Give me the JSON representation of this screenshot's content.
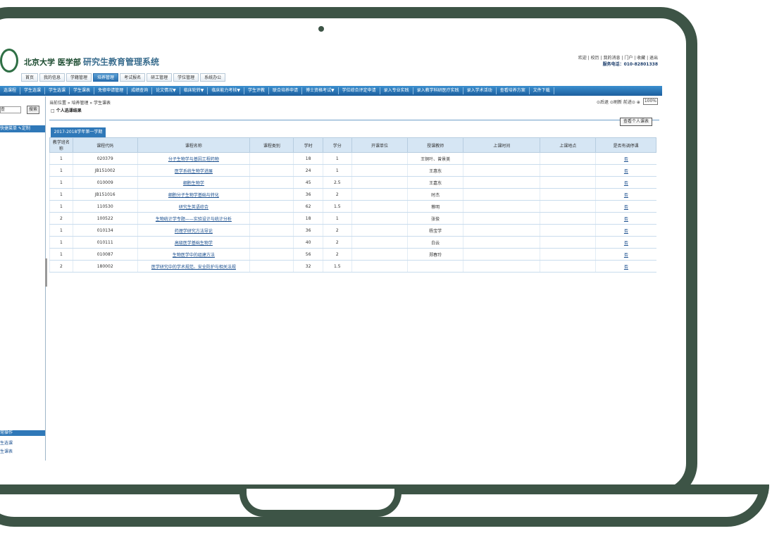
{
  "header": {
    "univ": "北京大学 医学部",
    "system": "研究生教育管理系统",
    "welcome": "欢迎",
    "links": "| 校历 | 我的消息 | 门户 | 收藏 | 退出",
    "phone": "服务电话：010-82801338"
  },
  "navtabs": [
    {
      "label": "首页",
      "active": false
    },
    {
      "label": "我的信息",
      "active": false
    },
    {
      "label": "学籍管理",
      "active": false
    },
    {
      "label": "培养管理",
      "active": true
    },
    {
      "label": "考试报名",
      "active": false
    },
    {
      "label": "研工管理",
      "active": false
    },
    {
      "label": "学位管理",
      "active": false
    },
    {
      "label": "系统办公",
      "active": false
    }
  ],
  "menubar": [
    "选课程",
    "学生选课",
    "学生选课",
    "学生课表",
    "免修申请管理",
    "成绩查询",
    "论文情况▼",
    "临床轮转▼",
    "临床能力考核▼",
    "学生评教",
    "联合培养申请",
    "博士资格考试▼",
    "学位综合评定申请",
    "录入专业实践",
    "录入教学科研医疗实践",
    "录入学术活动",
    "查看培养方案",
    "文件下载"
  ],
  "sidebar": {
    "search_value": "查",
    "search_button": "搜索",
    "head": "快捷菜单  ✎定制",
    "ops_head": "常操作",
    "links": [
      "生选课",
      "生课表"
    ]
  },
  "content": {
    "crumb": "当前位置 » 培养管理 » 学生课表",
    "toolbar": "⊙后退 ⊙刷新 前进⊙ ⊕",
    "zoom": "100%",
    "page_title": "□ 个人选课结果",
    "view_button": "查看个人课表",
    "term_tab": "2017-2018学年第一学期"
  },
  "table": {
    "headers": [
      "教学班名称",
      "课程代码",
      "课程名称",
      "课程类别",
      "学时",
      "学分",
      "开课单位",
      "授课教师",
      "上课时间",
      "上课地点",
      "是否有调停课"
    ],
    "rows": [
      [
        "1",
        "020379",
        "分子生物学与基因工程药物",
        "",
        "18",
        "1",
        "",
        "王铜叶、曾景美",
        "",
        "",
        "否"
      ],
      [
        "1",
        "JB151002",
        "医学系统生物学进展",
        "",
        "24",
        "1",
        "",
        "王惠东",
        "",
        "",
        "否"
      ],
      [
        "1",
        "010009",
        "细胞生物学",
        "",
        "45",
        "2.5",
        "",
        "王嘉东",
        "",
        "",
        "否"
      ],
      [
        "1",
        "JB151016",
        "细胞分子生物学基础与转化",
        "",
        "36",
        "2",
        "",
        "时杰",
        "",
        "",
        "否"
      ],
      [
        "1",
        "110530",
        "研究生英语综合",
        "",
        "62",
        "1.5",
        "",
        "蔡明",
        "",
        "",
        "否"
      ],
      [
        "2",
        "100522",
        "生物统计学专题——实验设计与统计分析",
        "",
        "18",
        "1",
        "",
        "张俊",
        "",
        "",
        "否"
      ],
      [
        "1",
        "010134",
        "药理学研究方法导论",
        "",
        "36",
        "2",
        "",
        "杨宝学",
        "",
        "",
        "否"
      ],
      [
        "1",
        "010111",
        "高级医学基础生物学",
        "",
        "40",
        "2",
        "",
        "白云",
        "",
        "",
        "否"
      ],
      [
        "1",
        "010087",
        "生物医学中的组建方法",
        "",
        "56",
        "2",
        "",
        "郑春玲",
        "",
        "",
        "否"
      ],
      [
        "2",
        "180002",
        "医学研究中的学术规范、安全防护与相关法规",
        "",
        "32",
        "1.5",
        "",
        "",
        "",
        "",
        "否"
      ]
    ]
  },
  "colors": {
    "frame": "#3d5446",
    "menubar": "#2a72b4",
    "accent": "#2f78b8"
  }
}
